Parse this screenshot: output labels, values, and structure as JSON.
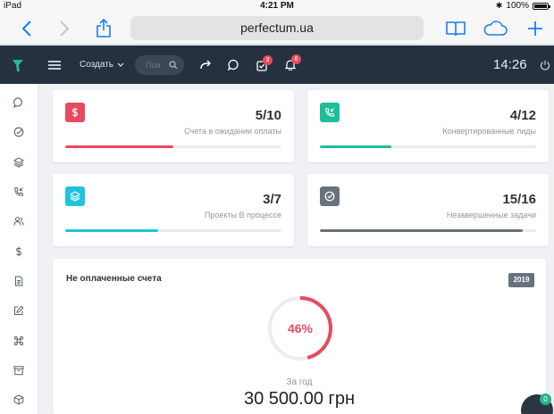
{
  "ios_status": {
    "device": "iPad",
    "time": "4:21 PM",
    "battery": "100%"
  },
  "browser": {
    "url": "perfectum.ua"
  },
  "header": {
    "create_label": "Создать",
    "search_placeholder": "Пои",
    "tasks_badge": "3",
    "notifications_badge": "6",
    "clock": "14:26"
  },
  "stats": [
    {
      "value": "5/10",
      "label": "Счета в ожидании оплаты",
      "progress": 0.5,
      "color": "#e84a5f",
      "icon": "dollar-icon"
    },
    {
      "value": "4/12",
      "label": "Конвертированные лиды",
      "progress": 0.33,
      "color": "#1bbf9a",
      "icon": "phone-incoming-icon"
    },
    {
      "value": "3/7",
      "label": "Проекты В процессе",
      "progress": 0.43,
      "color": "#1fc3dd",
      "icon": "layers-icon"
    },
    {
      "value": "15/16",
      "label": "Незавершенные задачи",
      "progress": 0.94,
      "color": "#68727d",
      "icon": "check-circle-icon"
    }
  ],
  "unpaid": {
    "title": "Не оплаченные счета",
    "year": "2019",
    "percent_label": "46%",
    "percent": 0.46,
    "period": "За год",
    "amount": "30 500.00 грн",
    "accent": "#e84a5f"
  },
  "chat_badge": "0"
}
